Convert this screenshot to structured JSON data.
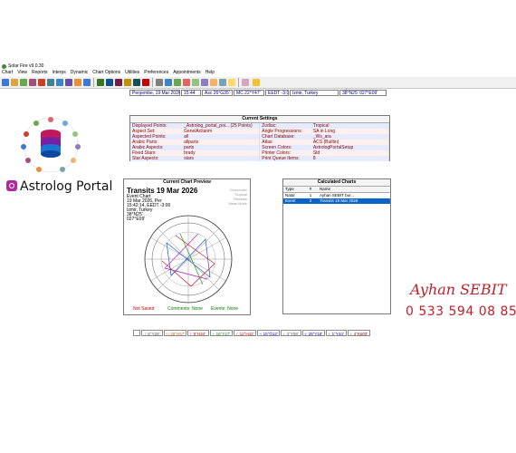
{
  "window": {
    "title": "Solar Fire v9.0.30"
  },
  "menu": [
    "Chart",
    "View",
    "Reports",
    "Interps",
    "Dynamic",
    "Chart Options",
    "Utilities",
    "Preferences",
    "Appointments",
    "Help"
  ],
  "status_row": [
    "Perşembe, 19 Mar 2026",
    "15:44",
    "Asc 26°G35'",
    "MC 22°Y47'",
    "EEDT -3:00",
    "Izmir, Turkey",
    "38°N25' 027°E09'"
  ],
  "current_settings": {
    "title": "Current Settings",
    "rows": [
      {
        "k1": "Displayed Points:",
        "v1": "_Astrolog_portal_poi... (25 Points)",
        "k2": "Zodiac:",
        "v2": "Tropical"
      },
      {
        "k1": "Aspect Set:",
        "v1": "GenelAcilarim",
        "k2": "Angle Progressions:",
        "v2": "SA in Long"
      },
      {
        "k1": "Aspected Points:",
        "v1": "all",
        "k2": "Chart Database:",
        "v2": "_Ws_ara"
      },
      {
        "k1": "Arabic Parts:",
        "v1": "allparts",
        "k2": "Atlas:",
        "v2": "ACS (Builtin)"
      },
      {
        "k1": "Arabic Aspects:",
        "v1": "parts",
        "k2": "Screen Colors:",
        "v2": "AstrologPortalSetup"
      },
      {
        "k1": "Fixed Stars:",
        "v1": "brady",
        "k2": "Printer Colors:",
        "v2": "Std"
      },
      {
        "k1": "Star Aspects:",
        "v1": "stars",
        "k2": "Print Queue Items:",
        "v2": "8"
      }
    ]
  },
  "preview": {
    "title": "Current Chart Preview",
    "heading": "Transits 19 Mar 2026",
    "details": [
      "Event Chart",
      "19 Mar 2026, Per",
      "15:42:14, EEDT -3:00",
      "Izmir, Turkey",
      "38°N25'",
      "027°E09'"
    ],
    "legend": [
      "Geocentric",
      "Tropical",
      "Placidus",
      "Mean Node"
    ],
    "footer_left": "Not Saved",
    "footer_mid": "Comments: None",
    "footer_right": "Events: None"
  },
  "calculated": {
    "title": "Calculated Charts",
    "headers": [
      "Type",
      "#",
      "Name"
    ],
    "rows": [
      {
        "type": "Natal",
        "num": "1",
        "name": "Ayhan SEBIT bur...",
        "selected": false
      },
      {
        "type": "Event",
        "num": "2",
        "name": "Transits 19 Mar 2026",
        "selected": true
      }
    ]
  },
  "bottom_planets": [
    "☽ 8°Y28'",
    "☉ 28°H57'",
    "☿ 9°H34'",
    "♀ 16°Y17'",
    "♂ 12°H42'",
    "♃ 15°Ö12'",
    "♄ 3°Y58'",
    "♅ 28°Y18'",
    "♆ 1°Y44'",
    "♇ 4°Kü03'"
  ],
  "branding": {
    "portal": "Astrolog Portal",
    "signature": "Ayhan SEBIT",
    "phone": "0 533 594 08 85"
  },
  "colors": {
    "settings_key": "#800000",
    "selection": "#0a64c8",
    "brand_red": "#c0202a",
    "instagram": "#b0289c"
  }
}
